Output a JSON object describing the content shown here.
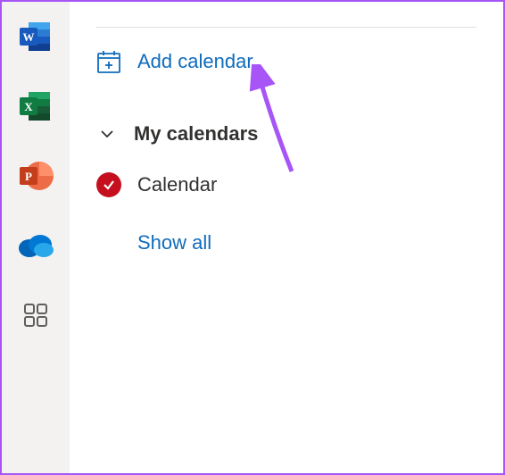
{
  "rail": {
    "apps": [
      "word",
      "excel",
      "powerpoint",
      "onedrive",
      "apps"
    ]
  },
  "sidebar": {
    "addCalendar": "Add calendar",
    "section": "My calendars",
    "items": [
      {
        "label": "Calendar",
        "checked": true
      }
    ],
    "showAll": "Show all"
  }
}
